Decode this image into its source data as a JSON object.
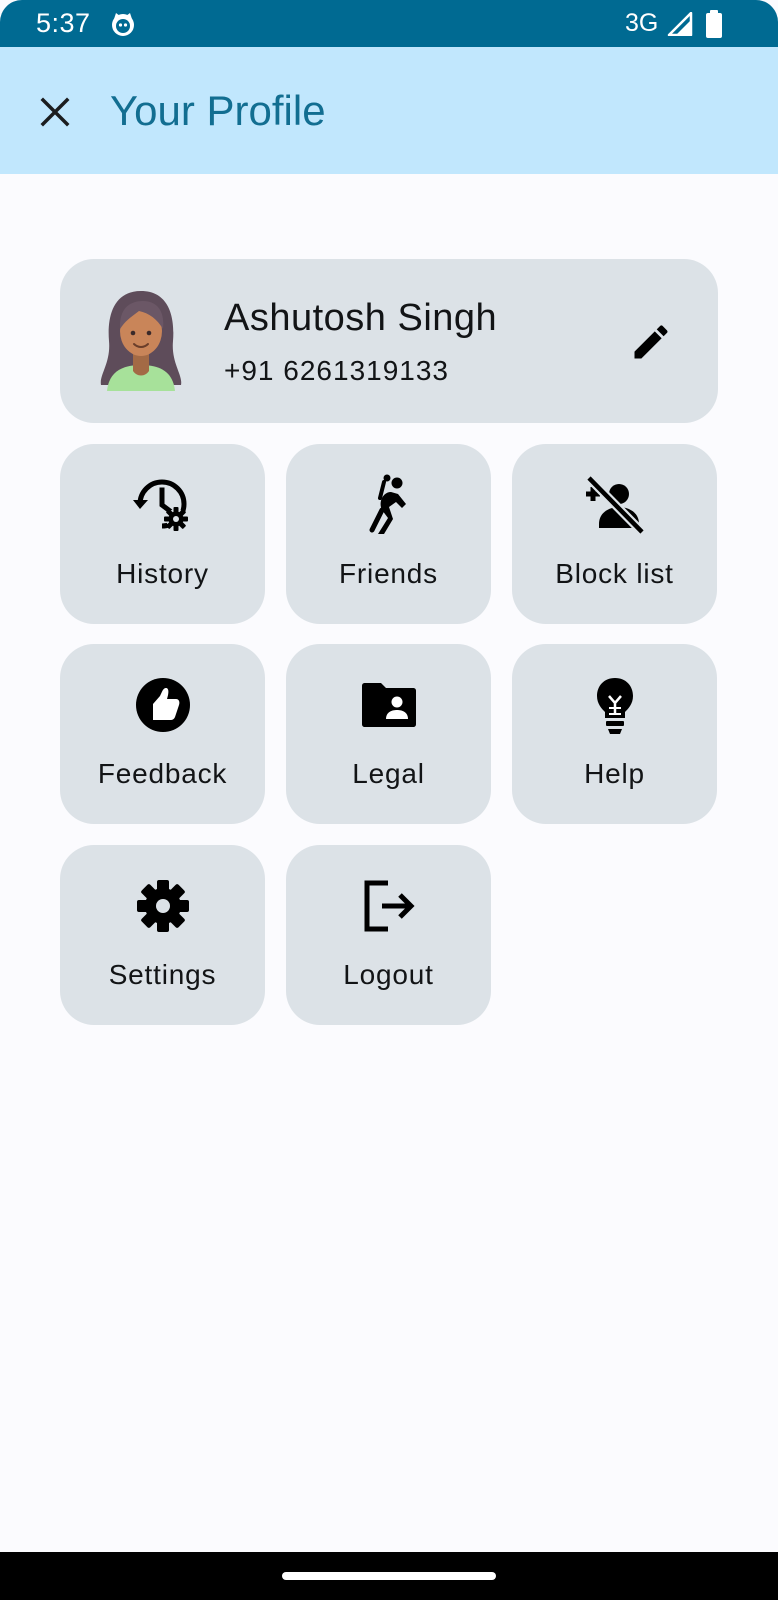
{
  "status_bar": {
    "time": "5:37",
    "network": "3G",
    "background_color": "#006a92",
    "icons": [
      "app-notification-icon",
      "cellular-signal-icon",
      "battery-icon"
    ]
  },
  "app_bar": {
    "title": "Your Profile",
    "close_icon": "close-icon",
    "background_color": "#c1e7fd",
    "title_color": "#126e91"
  },
  "profile": {
    "name": "Ashutosh Singh",
    "phone": "+91 6261319133",
    "avatar_icon": "avatar",
    "edit_icon": "edit-pencil-icon"
  },
  "menu": {
    "card_color": "#dce2e7",
    "items": [
      {
        "label": "History",
        "icon": "history-settings-icon"
      },
      {
        "label": "Friends",
        "icon": "sports-handball-icon"
      },
      {
        "label": "Block list",
        "icon": "person-off-icon"
      },
      {
        "label": "Feedback",
        "icon": "thumb-up-circle-icon"
      },
      {
        "label": "Legal",
        "icon": "folder-shared-icon"
      },
      {
        "label": "Help",
        "icon": "lightbulb-icon"
      },
      {
        "label": "Settings",
        "icon": "gear-icon"
      },
      {
        "label": "Logout",
        "icon": "logout-icon"
      }
    ]
  }
}
